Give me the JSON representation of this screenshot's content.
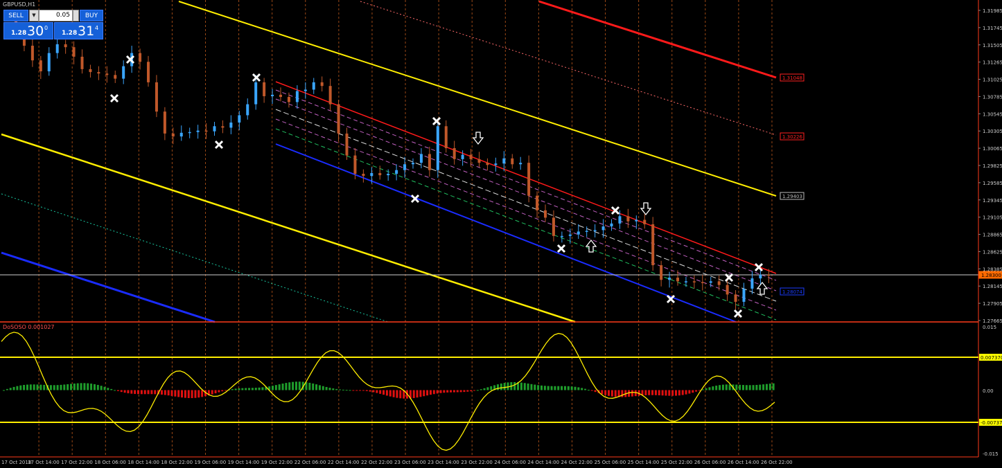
{
  "symbol": "GBPUSD,H1",
  "indicator_label": "DoSOSO 0.001027",
  "trade_panel": {
    "sell_label": "SELL",
    "buy_label": "BUY",
    "lot": "0.05",
    "bid_small": "1.28",
    "bid_big": "30",
    "bid_sup": "0",
    "ask_small": "1.28",
    "ask_big": "31",
    "ask_sup": "4"
  },
  "price_axis": {
    "labels": [
      "1.31985",
      "1.31745",
      "1.31505",
      "1.31265",
      "1.31025",
      "1.30785",
      "1.30545",
      "1.30305",
      "1.30065",
      "1.29825",
      "1.29585",
      "1.29345",
      "1.29105",
      "1.28865",
      "1.28625",
      "1.28385",
      "1.28145",
      "1.27905",
      "1.27665"
    ],
    "badges": [
      {
        "text": "1.31048",
        "color": "#ff2020"
      },
      {
        "text": "1.30226",
        "color": "#ff2020"
      },
      {
        "text": "1.29403",
        "color": "#bbbbbb"
      },
      {
        "text": "1.28300",
        "color": "#ff6a00"
      },
      {
        "text": "1.28074",
        "color": "#1a3cff"
      }
    ]
  },
  "indicator_axis": {
    "labels": [
      "0.015",
      "0.00",
      "-0.015"
    ],
    "badges": [
      {
        "text": "0.007370",
        "color": "#ffff00"
      },
      {
        "text": "-0.007370",
        "color": "#ffff00"
      }
    ]
  },
  "time_axis": [
    "17 Oct 2018",
    "17 Oct 14:00",
    "17 Oct 22:00",
    "18 Oct 06:00",
    "18 Oct 14:00",
    "18 Oct 22:00",
    "19 Oct 06:00",
    "19 Oct 14:00",
    "19 Oct 22:00",
    "22 Oct 06:00",
    "22 Oct 14:00",
    "22 Oct 22:00",
    "23 Oct 06:00",
    "23 Oct 14:00",
    "23 Oct 22:00",
    "24 Oct 06:00",
    "24 Oct 14:00",
    "24 Oct 22:00",
    "25 Oct 06:00",
    "25 Oct 14:00",
    "25 Oct 22:00",
    "26 Oct 06:00",
    "26 Oct 14:00",
    "26 Oct 22:00"
  ],
  "colors": {
    "background": "#000000",
    "bull_candle": "#3aa6ff",
    "bear_candle": "#c0582a",
    "grid": "#b8561a",
    "pitchfork_yellow": "#ffee00",
    "upper_red": "#ff1a1a",
    "lower_blue": "#1a2cff",
    "current_price_line": "#cfcfcf",
    "histogram_up": "#1f9e2c",
    "histogram_down": "#e01010",
    "oscillator": "#ffee00"
  },
  "chart_data": {
    "type": "candlestick",
    "title": "GBPUSD,H1",
    "ylim": [
      1.27625,
      1.32025
    ],
    "current_price": 1.283,
    "levels": [
      1.31048,
      1.30226,
      1.29403,
      1.28074
    ],
    "candles_close": [
      1.316,
      1.314,
      1.312,
      1.3105,
      1.313,
      1.3142,
      1.3138,
      1.3125,
      1.3108,
      1.3104,
      1.3102,
      1.31,
      1.3095,
      1.3112,
      1.313,
      1.3118,
      1.309,
      1.305,
      1.302,
      1.3016,
      1.3021,
      1.3022,
      1.3024,
      1.3023,
      1.303,
      1.3028,
      1.3035,
      1.3045,
      1.306,
      1.309,
      1.3071,
      1.3073,
      1.307,
      1.3063,
      1.3078,
      1.308,
      1.309,
      1.3085,
      1.306,
      1.302,
      1.299,
      1.2965,
      1.2962,
      1.2966,
      1.2963,
      1.2965,
      1.297,
      1.2978,
      1.298,
      1.2992,
      1.297,
      1.303,
      1.3,
      1.2985,
      1.2991,
      1.2985,
      1.298,
      1.2977,
      1.2979,
      1.2986,
      1.2978,
      1.298,
      1.2935,
      1.2915,
      1.2905,
      1.288,
      1.288,
      1.2882,
      1.2886,
      1.2887,
      1.2888,
      1.2893,
      1.2897,
      1.2907,
      1.29,
      1.2902,
      1.2896,
      1.284,
      1.282,
      1.2823,
      1.2818,
      1.2818,
      1.2817,
      1.2816,
      1.2818,
      1.2813,
      1.28,
      1.279,
      1.2808,
      1.2822,
      1.2827,
      1.2826
    ],
    "arrows": [
      {
        "type": "down",
        "index": 50
      },
      {
        "type": "up",
        "index": 72
      },
      {
        "type": "down",
        "index": 77
      },
      {
        "type": "up",
        "index": 90
      }
    ],
    "indicator": {
      "name": "DoSOSO",
      "value": 0.001027,
      "levels": [
        0.00737,
        -0.00737
      ],
      "ylim": [
        -0.015,
        0.015
      ]
    }
  }
}
